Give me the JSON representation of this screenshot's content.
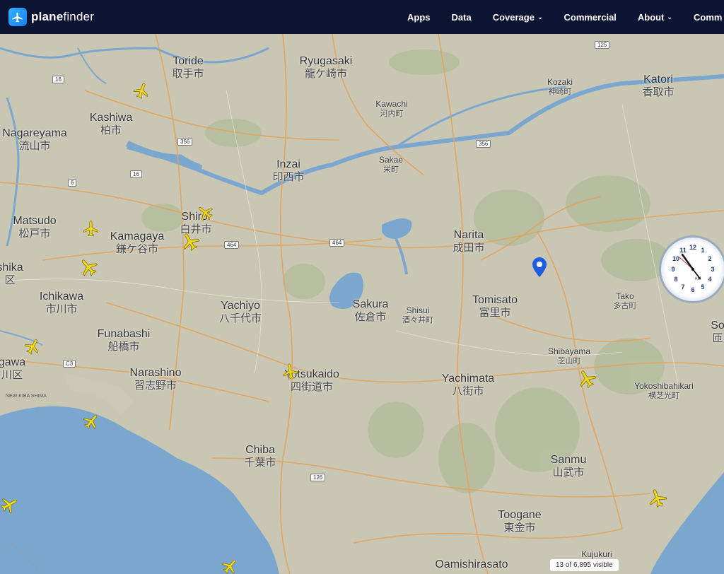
{
  "header": {
    "logo_bold": "plane",
    "logo_rest": "finder",
    "nav": [
      {
        "label": "Apps",
        "dropdown": false
      },
      {
        "label": "Data",
        "dropdown": false
      },
      {
        "label": "Coverage",
        "dropdown": true
      },
      {
        "label": "Commercial",
        "dropdown": false
      },
      {
        "label": "About",
        "dropdown": true
      },
      {
        "label": "Comm",
        "dropdown": false
      }
    ]
  },
  "cities": [
    {
      "id": "toride",
      "en": "Toride",
      "jp": "取手市",
      "size": "large"
    },
    {
      "id": "ryugasaki",
      "en": "Ryugasaki",
      "jp": "龍ケ崎市",
      "size": "large"
    },
    {
      "id": "katori",
      "en": "Katori",
      "jp": "香取市",
      "size": "large"
    },
    {
      "id": "kozaki",
      "en": "Kozaki",
      "jp": "神崎町",
      "size": "small"
    },
    {
      "id": "kawachi",
      "en": "Kawachi",
      "jp": "河内町",
      "size": "small"
    },
    {
      "id": "kashiwa",
      "en": "Kashiwa",
      "jp": "柏市",
      "size": "large"
    },
    {
      "id": "nagareyama",
      "en": "Nagareyama",
      "jp": "流山市",
      "size": "large"
    },
    {
      "id": "inzai",
      "en": "Inzai",
      "jp": "印西市",
      "size": "large"
    },
    {
      "id": "sakae",
      "en": "Sakae",
      "jp": "栄町",
      "size": "small"
    },
    {
      "id": "matsudo",
      "en": "Matsudo",
      "jp": "松戸市",
      "size": "large"
    },
    {
      "id": "shiroi",
      "en": "Shiroi",
      "jp": "白井市",
      "size": "large"
    },
    {
      "id": "kamagaya",
      "en": "Kamagaya",
      "jp": "鎌ケ谷市",
      "size": "large"
    },
    {
      "id": "narita",
      "en": "Narita",
      "jp": "成田市",
      "size": "large"
    },
    {
      "id": "kashiwa2",
      "en": "shika",
      "jp": "区",
      "size": "large"
    },
    {
      "id": "ichikawa",
      "en": "Ichikawa",
      "jp": "市川市",
      "size": "large"
    },
    {
      "id": "yachiyo",
      "en": "Yachiyo",
      "jp": "八千代市",
      "size": "large"
    },
    {
      "id": "sakura",
      "en": "Sakura",
      "jp": "佐倉市",
      "size": "large"
    },
    {
      "id": "shisui",
      "en": "Shisui",
      "jp": "酒々井町",
      "size": "small"
    },
    {
      "id": "tomisato",
      "en": "Tomisato",
      "jp": "富里市",
      "size": "large"
    },
    {
      "id": "tako",
      "en": "Tako",
      "jp": "多古町",
      "size": "small"
    },
    {
      "id": "so",
      "en": "So",
      "jp": "匝",
      "size": "large"
    },
    {
      "id": "funabashi",
      "en": "Funabashi",
      "jp": "船橋市",
      "size": "large"
    },
    {
      "id": "gawa",
      "en": "gawa",
      "jp": "川区",
      "size": "large"
    },
    {
      "id": "shibayama",
      "en": "Shibayama",
      "jp": "芝山町",
      "size": "small"
    },
    {
      "id": "narashino",
      "en": "Narashino",
      "jp": "習志野市",
      "size": "large"
    },
    {
      "id": "yotsukaido",
      "en": "Yotsukaido",
      "jp": "四街道市",
      "size": "large"
    },
    {
      "id": "yachimata",
      "en": "Yachimata",
      "jp": "八街市",
      "size": "large"
    },
    {
      "id": "yokoshibahikari",
      "en": "Yokoshibahikari",
      "jp": "横芝光町",
      "size": "small"
    },
    {
      "id": "chiba",
      "en": "Chiba",
      "jp": "千葉市",
      "size": "large"
    },
    {
      "id": "sanmu",
      "en": "Sanmu",
      "jp": "山武市",
      "size": "large"
    },
    {
      "id": "toogane",
      "en": "Toogane",
      "jp": "東金市",
      "size": "large"
    },
    {
      "id": "kujukuri",
      "en": "Kujukuri",
      "jp": "",
      "size": "small"
    },
    {
      "id": "oamishirasato",
      "en": "Oamishirasato",
      "jp": "",
      "size": "large"
    }
  ],
  "roads": [
    "125",
    "16",
    "356",
    "16",
    "6",
    "356",
    "464",
    "464",
    "C3",
    "126"
  ],
  "shinkiba": "NEW KIBA SHIMA",
  "clock": {
    "label": "AM",
    "numbers": [
      "12",
      "1",
      "2",
      "3",
      "4",
      "5",
      "6",
      "7",
      "8",
      "9",
      "10",
      "11"
    ]
  },
  "counter": "13 of 6,895 visible",
  "colors": {
    "header": "#0c1433",
    "land": "#c9c6b3",
    "water": "#7ba7cf",
    "plane": "#f2d81e",
    "pin": "#1f5de0"
  }
}
